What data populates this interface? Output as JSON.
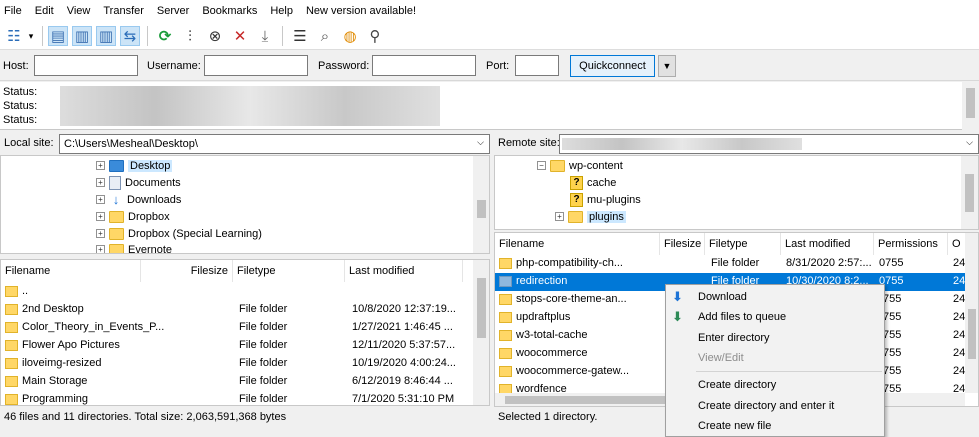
{
  "menu": [
    "File",
    "Edit",
    "View",
    "Transfer",
    "Server",
    "Bookmarks",
    "Help",
    "New version available!"
  ],
  "toolbar": {
    "icons": [
      "site-manager-icon",
      "dropdown-arrow-icon",
      "toggle-message-log-icon",
      "toggle-local-tree-icon",
      "toggle-remote-tree-icon",
      "toggle-transfer-queue-icon",
      "refresh-icon",
      "process-queue-icon",
      "cancel-icon",
      "disconnect-icon",
      "reconnect-icon",
      "filter-icon",
      "compare-icon",
      "sync-browse-icon",
      "search-icon"
    ]
  },
  "quickconnect": {
    "host_label": "Host:",
    "username_label": "Username:",
    "password_label": "Password:",
    "port_label": "Port:",
    "host_value": "",
    "username_value": "",
    "password_value": "",
    "port_value": "",
    "button_label": "Quickconnect"
  },
  "log": [
    {
      "label": "Status:"
    },
    {
      "label": "Status:"
    },
    {
      "label": "Status:"
    }
  ],
  "local": {
    "label": "Local site:",
    "path": "C:\\Users\\Mesheal\\Desktop\\",
    "tree": [
      "Desktop",
      "Documents",
      "Downloads",
      "Dropbox",
      "Dropbox (Special Learning)",
      "Evernote"
    ],
    "columns": [
      "Filename",
      "Filesize",
      "Filetype",
      "Last modified"
    ],
    "rows": [
      {
        "name": "..",
        "size": "",
        "type": "",
        "modified": ""
      },
      {
        "name": "2nd Desktop",
        "size": "",
        "type": "File folder",
        "modified": "10/8/2020 12:37:19..."
      },
      {
        "name": "Color_Theory_in_Events_P...",
        "size": "",
        "type": "File folder",
        "modified": "1/27/2021 1:46:45 ..."
      },
      {
        "name": "Flower Apo Pictures",
        "size": "",
        "type": "File folder",
        "modified": "12/11/2020 5:37:57..."
      },
      {
        "name": "iloveimg-resized",
        "size": "",
        "type": "File folder",
        "modified": "10/19/2020 4:00:24..."
      },
      {
        "name": "Main Storage",
        "size": "",
        "type": "File folder",
        "modified": "6/12/2019 8:46:44 ..."
      },
      {
        "name": "Programming",
        "size": "",
        "type": "File folder",
        "modified": "7/1/2020 5:31:10 PM"
      }
    ],
    "status": "46 files and 11 directories. Total size: 2,063,591,368 bytes"
  },
  "remote": {
    "label": "Remote site:",
    "path": "",
    "tree": [
      "wp-content",
      "cache",
      "mu-plugins",
      "plugins"
    ],
    "columns": [
      "Filename",
      "Filesize",
      "Filetype",
      "Last modified",
      "Permissions",
      "O"
    ],
    "rows": [
      {
        "name": "php-compatibility-ch...",
        "type": "File folder",
        "modified": "8/31/2020 2:57:...",
        "perm": "0755",
        "owner": "24"
      },
      {
        "name": "redirection",
        "type": "File folder",
        "modified": "10/30/2020 8:2...",
        "perm": "0755",
        "owner": "24",
        "selected": true
      },
      {
        "name": "stops-core-theme-an...",
        "type": "",
        "modified": "",
        "perm": "755",
        "owner": "24"
      },
      {
        "name": "updraftplus",
        "type": "",
        "modified": "",
        "perm": "755",
        "owner": "24"
      },
      {
        "name": "w3-total-cache",
        "type": "",
        "modified": "",
        "perm": "755",
        "owner": "24"
      },
      {
        "name": "woocommerce",
        "type": "",
        "modified": "",
        "perm": "755",
        "owner": "24"
      },
      {
        "name": "woocommerce-gatew...",
        "type": "",
        "modified": "",
        "perm": "755",
        "owner": "24"
      },
      {
        "name": "wordfence",
        "type": "",
        "modified": "",
        "perm": "755",
        "owner": "24"
      }
    ],
    "status": "Selected 1 directory."
  },
  "context_menu": {
    "items": [
      {
        "label": "Download",
        "icon": "download-arrow-icon",
        "enabled": true
      },
      {
        "label": "Add files to queue",
        "icon": "add-to-queue-icon",
        "enabled": true
      },
      {
        "label": "Enter directory",
        "icon": "",
        "enabled": true
      },
      {
        "label": "View/Edit",
        "icon": "",
        "enabled": false
      },
      {
        "label": "Create directory",
        "icon": "",
        "enabled": true
      },
      {
        "label": "Create directory and enter it",
        "icon": "",
        "enabled": true
      },
      {
        "label": "Create new file",
        "icon": "",
        "enabled": true
      }
    ]
  },
  "colors": {
    "selection": "#0078d7",
    "folder": "#ffd766",
    "accent_blue": "#1e74d6"
  }
}
